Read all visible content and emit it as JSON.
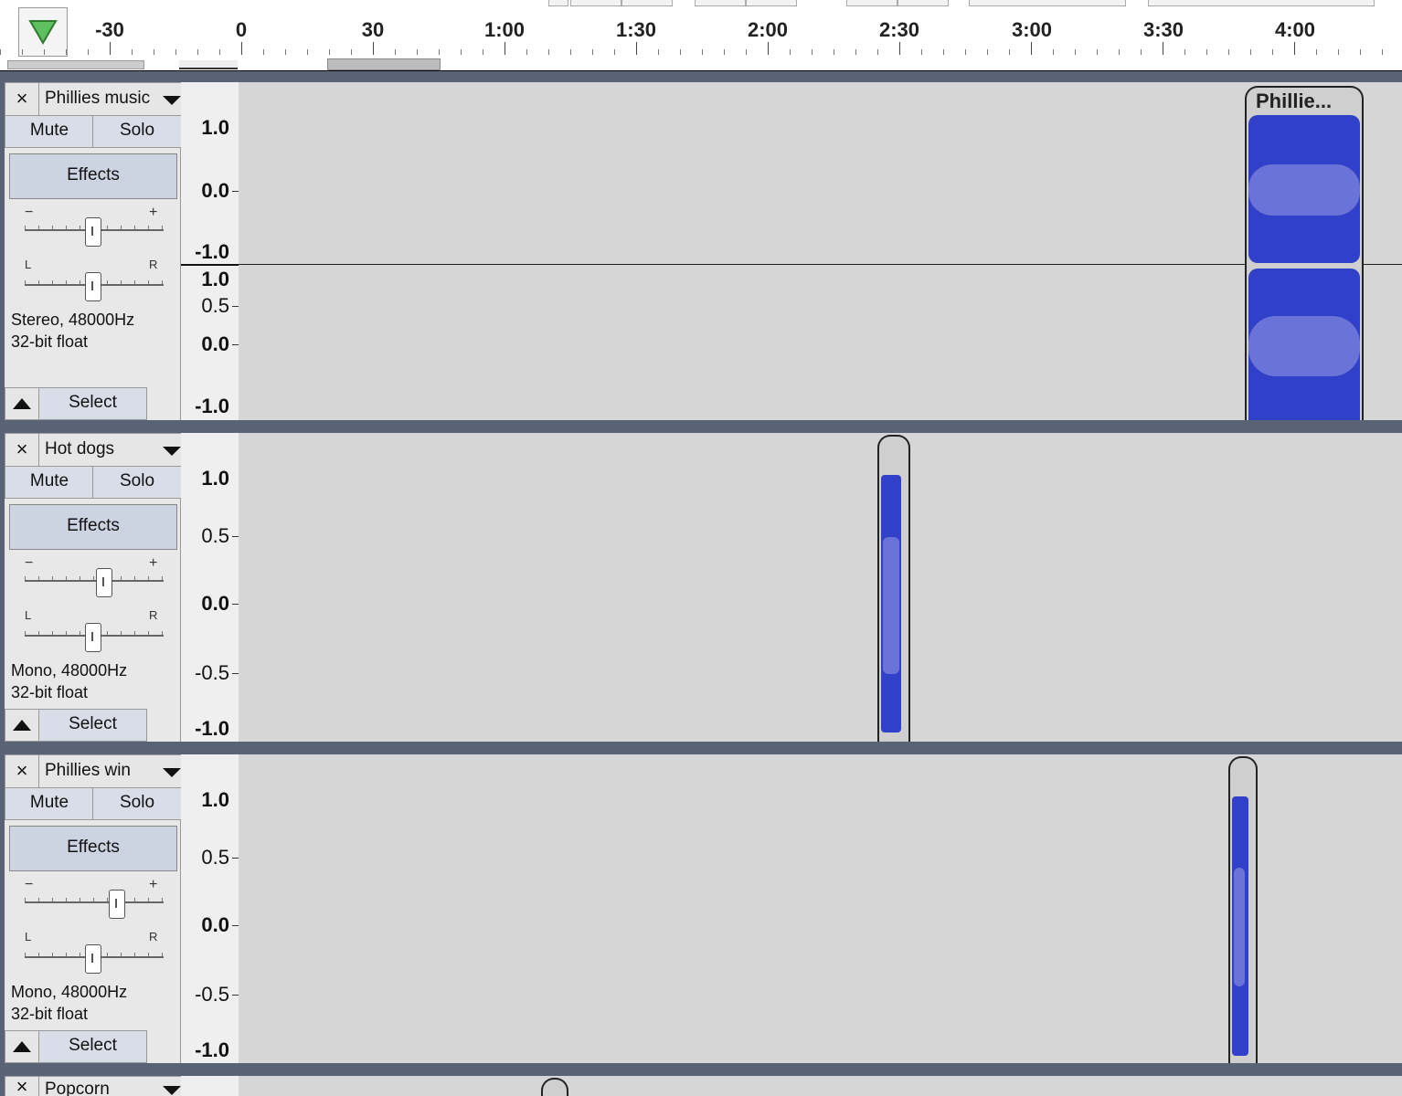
{
  "ruler": {
    "labels": [
      "-30",
      "0",
      "30",
      "1:00",
      "1:30",
      "2:00",
      "2:30",
      "3:00",
      "3:30",
      "4:00"
    ]
  },
  "colors": {
    "waveform": "#3040c8",
    "waveform_rms": "#6a74d8",
    "playhead": "#5ec05e",
    "track_bg": "#d6d6d6"
  },
  "common": {
    "mute_label": "Mute",
    "solo_label": "Solo",
    "effects_label": "Effects",
    "select_label": "Select",
    "close_glyph": "×",
    "gain_minus": "−",
    "gain_plus": "+",
    "pan_left": "L",
    "pan_right": "R"
  },
  "tracks": [
    {
      "name": "Phillies music",
      "format": "Stereo, 48000Hz",
      "bit_depth": "32-bit float",
      "clip_name": "Phillie...",
      "scale_top": [
        "1.0",
        "0.0",
        "-1.0"
      ],
      "scale_bottom": [
        "1.0",
        "0.5",
        "0.0",
        "-1.0"
      ]
    },
    {
      "name": "Hot dogs",
      "format": "Mono, 48000Hz",
      "bit_depth": "32-bit float",
      "scale": [
        "1.0",
        "0.5",
        "0.0",
        "-0.5",
        "-1.0"
      ]
    },
    {
      "name": "Phillies win",
      "format": "Mono, 48000Hz",
      "bit_depth": "32-bit float",
      "scale": [
        "1.0",
        "0.5",
        "0.0",
        "-0.5",
        "-1.0"
      ]
    },
    {
      "name": "Popcorn"
    }
  ]
}
